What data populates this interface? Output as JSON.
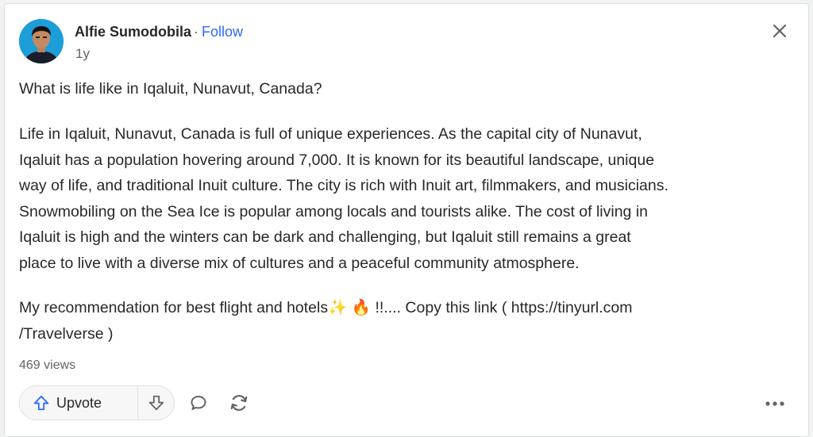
{
  "post": {
    "author": {
      "name": "Alfie Sumodobila",
      "separator": "·",
      "follow_label": "Follow",
      "time_ago": "1y"
    },
    "question": "What is life like in Iqaluit, Nunavut, Canada?",
    "answer_lines": [
      "Life in Iqaluit, Nunavut, Canada is full of unique experiences. As the capital city of Nunavut,",
      "Iqaluit has a population hovering around 7,000. It is known for its beautiful landscape, unique",
      "way of life, and traditional Inuit culture. The city is rich with Inuit art, filmmakers, and musicians.",
      "Snowmobiling on the Sea Ice is popular among locals and tourists alike. The cost of living in",
      "Iqaluit is high and the winters can be dark and challenging, but Iqaluit still remains a great",
      "place to live with a diverse mix of cultures and a peaceful community atmosphere."
    ],
    "recommendation_lines": [
      "My recommendation for best flight and hotels✨ 🔥 !!.... Copy this link ( https://tinyurl.com",
      "/Travelverse )"
    ],
    "views": "469 views"
  },
  "actions": {
    "upvote_label": "Upvote",
    "upvote_icon": "arrow-up-icon",
    "downvote_icon": "arrow-down-icon",
    "comment_icon": "comment-bubble-icon",
    "share_icon": "reshare-icon",
    "more_icon": "ellipsis-icon",
    "close_icon": "close-icon"
  },
  "colors": {
    "accent": "#2e69ff",
    "text": "#282829",
    "muted": "#636466",
    "border": "#dee0e1"
  }
}
